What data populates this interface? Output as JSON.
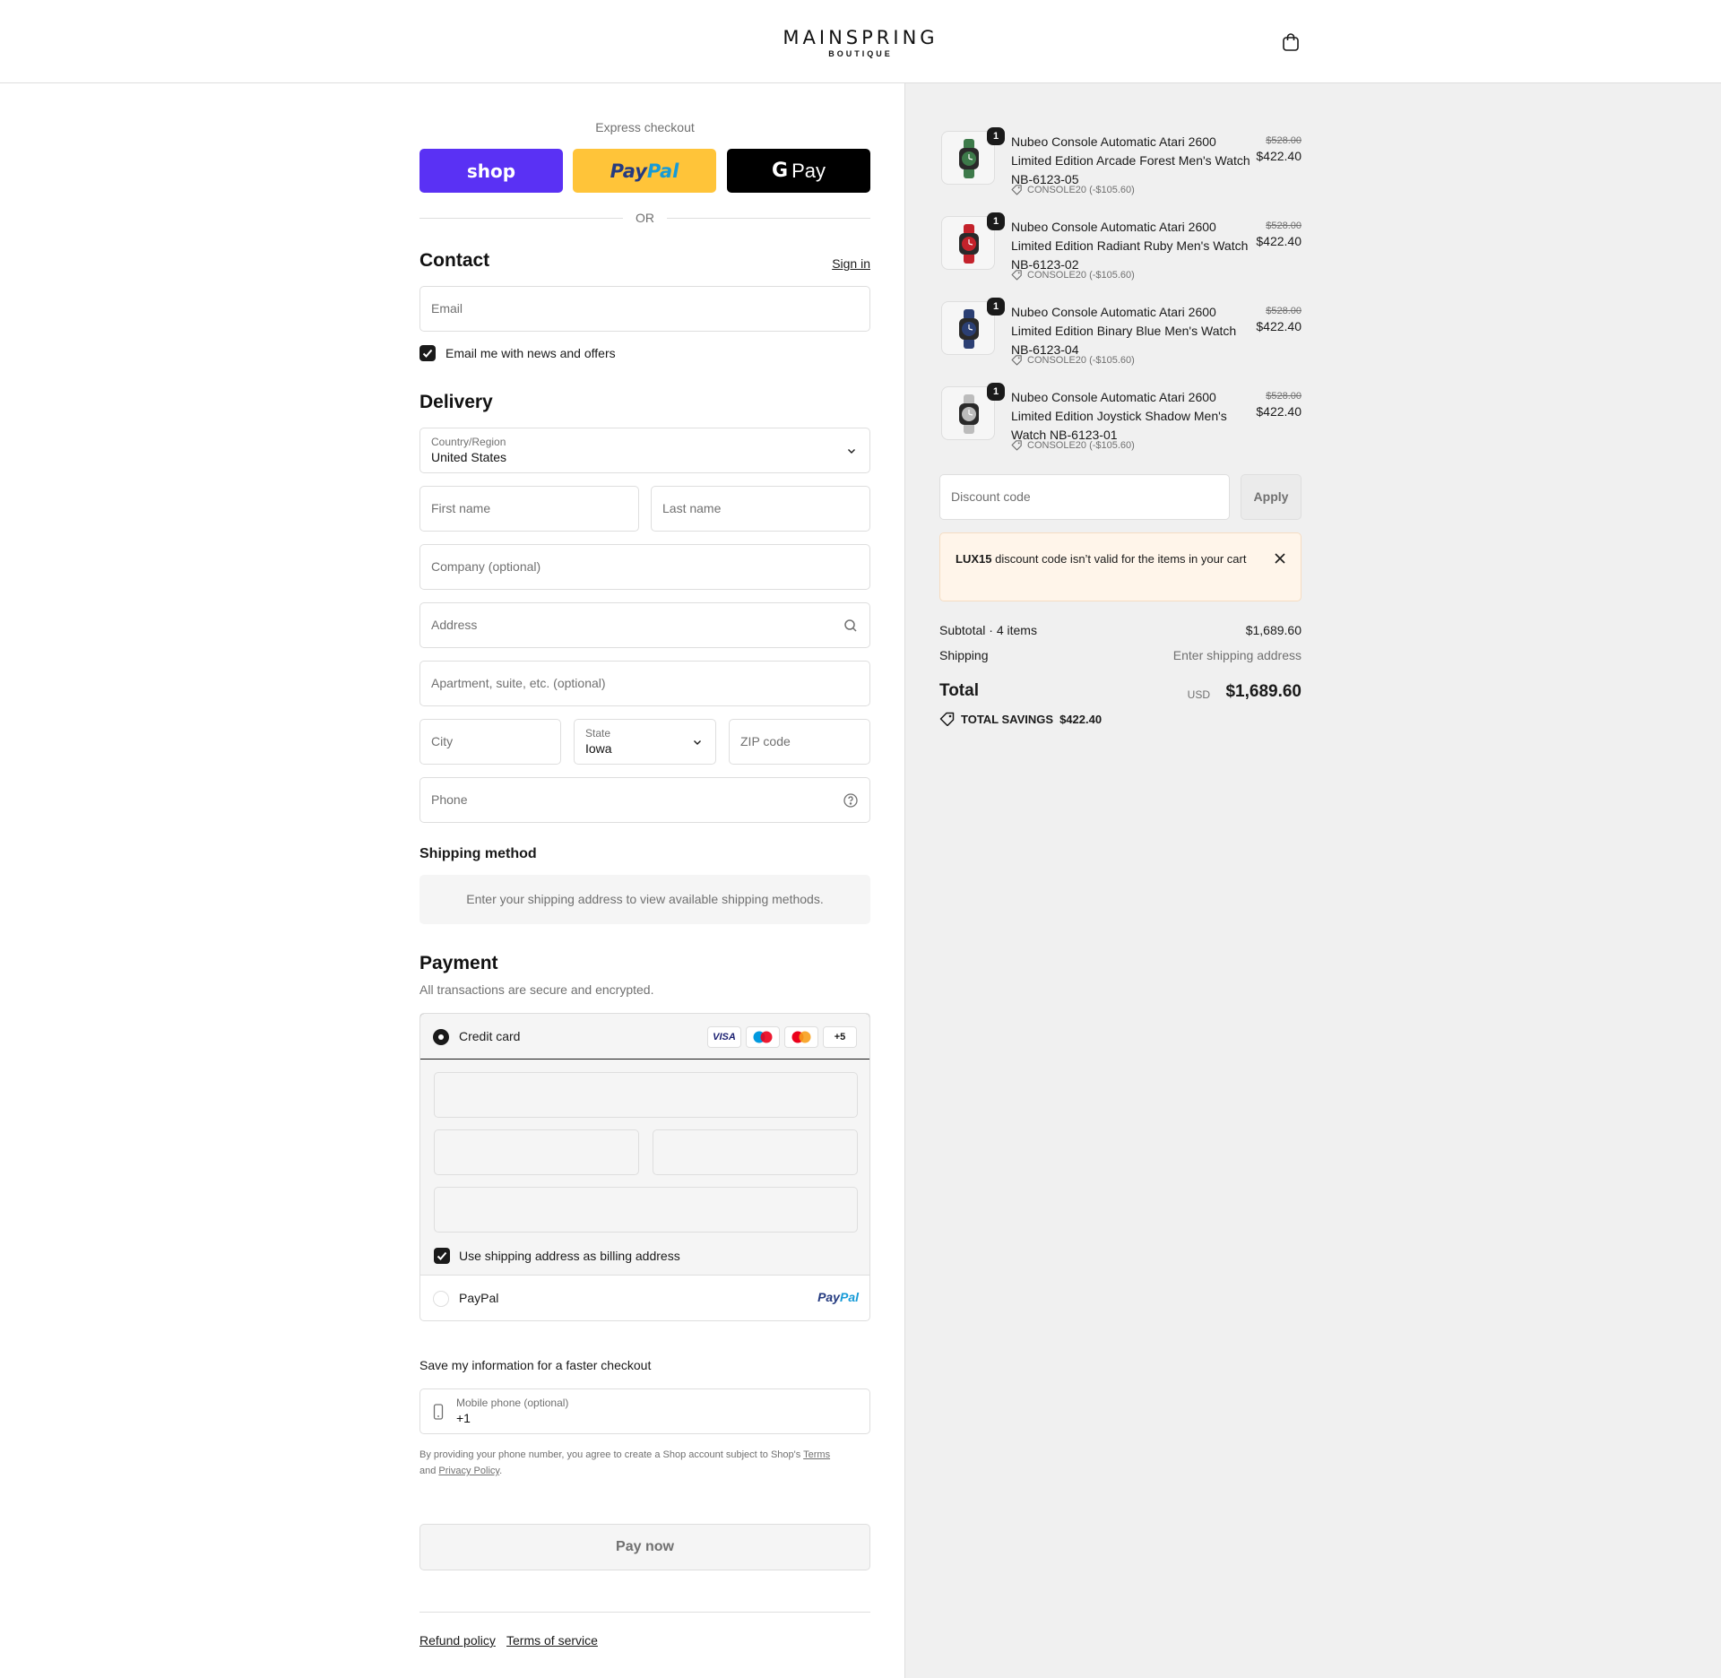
{
  "header": {
    "logo_main": "MAINSPRING",
    "logo_sub": "BOUTIQUE",
    "cart_icon": "shopping-bag-icon"
  },
  "express": {
    "title": "Express checkout",
    "shop_label": "shop",
    "paypal_label_1": "Pay",
    "paypal_label_2": "Pal",
    "gpay_g": "G",
    "gpay_label": "Pay",
    "or_label": "OR"
  },
  "contact": {
    "title": "Contact",
    "sign_in": "Sign in",
    "email_placeholder": "Email",
    "news_label": "Email me with news and offers",
    "news_checked": true
  },
  "delivery": {
    "title": "Delivery",
    "country_label": "Country/Region",
    "country_value": "United States",
    "first_name": "First name",
    "last_name": "Last name",
    "company": "Company (optional)",
    "address": "Address",
    "apartment": "Apartment, suite, etc. (optional)",
    "city": "City",
    "state_label": "State",
    "state_value": "Iowa",
    "zip": "ZIP code",
    "phone": "Phone"
  },
  "shipping_method": {
    "title": "Shipping method",
    "note": "Enter your shipping address to view available shipping methods."
  },
  "payment": {
    "title": "Payment",
    "subtitle": "All transactions are secure and encrypted.",
    "credit_card_label": "Credit card",
    "card_badges": [
      "VISA",
      "maestro",
      "mastercard",
      "+5"
    ],
    "billing_label": "Use shipping address as billing address",
    "paypal_label": "PayPal",
    "paypal_logo_1": "Pay",
    "paypal_logo_2": "Pal"
  },
  "save_info": {
    "title": "Save my information for a faster checkout",
    "mobile_label": "Mobile phone (optional)",
    "mobile_value": "+1",
    "legal_prefix": "By providing your phone number, you agree to create a Shop account subject to Shop's",
    "terms": "Terms",
    "and": "and",
    "privacy": "Privacy Policy",
    "period": "."
  },
  "pay_now": "Pay now",
  "footer": {
    "refund": "Refund policy",
    "tos": "Terms of service"
  },
  "cart": {
    "items": [
      {
        "name": "Nubeo Console Automatic Atari 2600 Limited Edition Arcade Forest Men's Watch NB-6123-05",
        "qty": "1",
        "discount": "CONSOLE20 (-$105.60)",
        "old_price": "$528.00",
        "price": "$422.40",
        "color": "#3d7a4a"
      },
      {
        "name": "Nubeo Console Automatic Atari 2600 Limited Edition Radiant Ruby Men's Watch NB-6123-02",
        "qty": "1",
        "discount": "CONSOLE20 (-$105.60)",
        "old_price": "$528.00",
        "price": "$422.40",
        "color": "#c4222b"
      },
      {
        "name": "Nubeo Console Automatic Atari 2600 Limited Edition Binary Blue Men's Watch NB-6123-04",
        "qty": "1",
        "discount": "CONSOLE20 (-$105.60)",
        "old_price": "$528.00",
        "price": "$422.40",
        "color": "#2b3f73"
      },
      {
        "name": "Nubeo Console Automatic Atari 2600 Limited Edition Joystick Shadow Men's Watch NB-6123-01",
        "qty": "1",
        "discount": "CONSOLE20 (-$105.60)",
        "old_price": "$528.00",
        "price": "$422.40",
        "color": "#bcbcbc"
      }
    ],
    "discount_placeholder": "Discount code",
    "apply": "Apply",
    "alert_code": "LUX15",
    "alert_text": "discount code isn’t valid for the items in your cart",
    "subtotal_label": "Subtotal · 4 items",
    "subtotal_value": "$1,689.60",
    "shipping_label": "Shipping",
    "shipping_value": "Enter shipping address",
    "total_label": "Total",
    "total_currency": "USD",
    "total_value": "$1,689.60",
    "savings_label": "TOTAL SAVINGS",
    "savings_value": "$422.40"
  },
  "colors": {
    "shop_purple": "#5a31f4",
    "paypal_yellow": "#ffc439",
    "dark": "#1a1a1a",
    "muted": "#707070",
    "alert_bg": "#fff5ea"
  }
}
